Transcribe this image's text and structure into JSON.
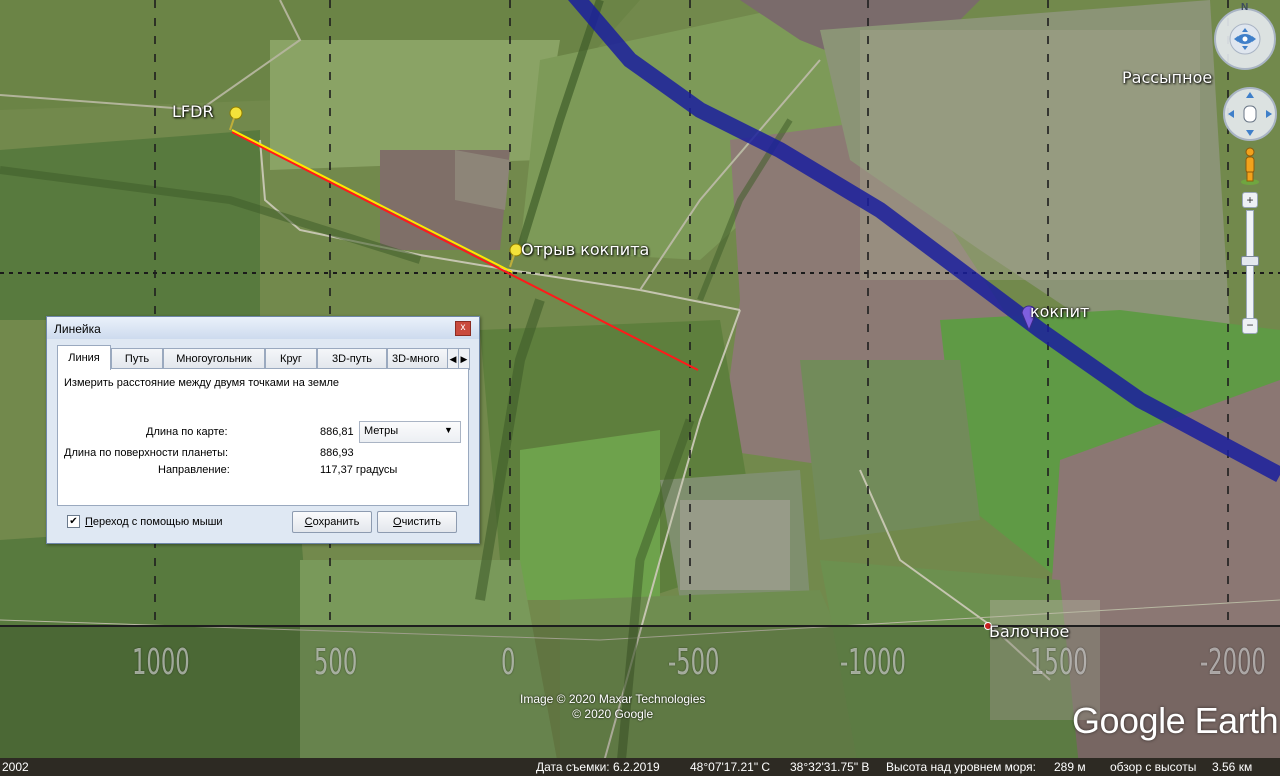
{
  "map": {
    "places": {
      "lfdr": "LFDR",
      "cockpit_break": "Отрыв кокпита",
      "cockpit": "кокпит",
      "rassypnoe": "Рассыпное",
      "balochnoe": "Балочное"
    },
    "scale_labels": [
      "1000",
      "500",
      "0",
      "-500",
      "-1000",
      "1500",
      "-2000"
    ],
    "credits": [
      "Image © 2020 Maxar Technologies",
      "© 2020 Google"
    ],
    "logo_text": "Google Earth",
    "colors": {
      "measure_line": "#ff1a1a",
      "measure_line_alt": "#ffe600",
      "flight_path": "#1a1f9e"
    }
  },
  "nav": {
    "compass_north": "N",
    "compass_icon": "compass-ring-icon",
    "look_icon": "hand-look-icon",
    "pegman_icon": "pegman-icon",
    "zoom_in": "+",
    "zoom_out": "−"
  },
  "status": {
    "left_text": "2002",
    "imagery_date": "Дата съемки: 6.2.2019",
    "lat": "48°07'17.21\" С",
    "lon": "38°32'31.75\" В",
    "elevation_label": "Высота над уровнем моря:",
    "elevation_value": "289 м",
    "eye_label": "обзор с высоты",
    "eye_value": "3.56 км"
  },
  "ruler": {
    "title": "Линейка",
    "close_label": "x",
    "tabs": [
      "Линия",
      "Путь",
      "Многоугольник",
      "Круг",
      "3D-путь",
      "3D-много"
    ],
    "active_tab": "Линия",
    "description": "Измерить расстояние между двумя точками на земле",
    "map_length_label": "Длина по карте:",
    "map_length_value": "886,81",
    "units_selected": "Метры",
    "ground_length_label": "Длина по поверхности планеты:",
    "ground_length_value": "886,93",
    "heading_label": "Направление:",
    "heading_value": "117,37 градусы",
    "mouse_nav_label": "Переход с помощью мыши",
    "mouse_nav_checked": true,
    "save_label": "Сохранить",
    "clear_label": "Очистить"
  }
}
